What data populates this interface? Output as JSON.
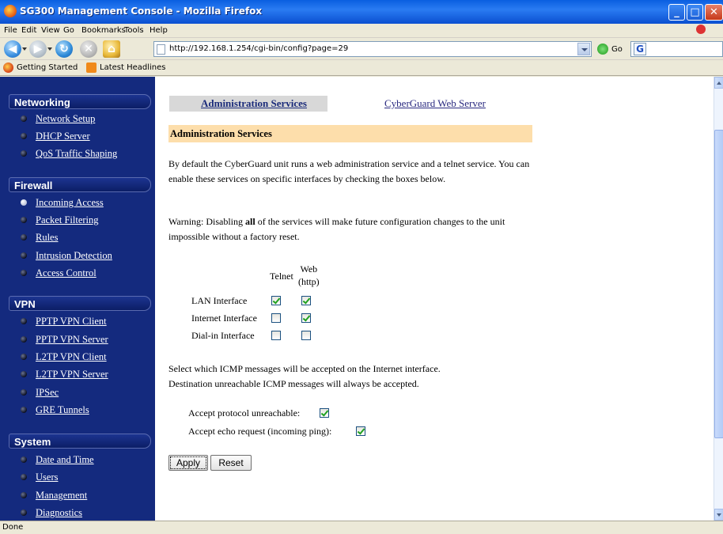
{
  "window": {
    "title": "SG300 Management Console - Mozilla Firefox"
  },
  "menu": [
    "File",
    "Edit",
    "View",
    "Go",
    "Bookmarks",
    "Tools",
    "Help"
  ],
  "toolbar": {
    "url": "http://192.168.1.254/cgi-bin/config?page=29",
    "go_label": "Go",
    "search_engine_glyph": "G"
  },
  "bookmarks": [
    "Getting Started",
    "Latest Headlines"
  ],
  "sidebar": {
    "networking": {
      "title": "Networking",
      "items": [
        "Network Setup",
        "DHCP Server",
        "QoS Traffic Shaping"
      ]
    },
    "firewall": {
      "title": "Firewall",
      "items": [
        "Incoming Access",
        "Packet Filtering",
        "Rules",
        "Intrusion Detection",
        "Access Control"
      ],
      "active": "Incoming Access"
    },
    "vpn": {
      "title": "VPN",
      "items": [
        "PPTP VPN Client",
        "PPTP VPN Server",
        "L2TP VPN Client",
        "L2TP VPN Server",
        "IPSec",
        "GRE Tunnels"
      ]
    },
    "system": {
      "title": "System",
      "items": [
        "Date and Time",
        "Users",
        "Management",
        "Diagnostics"
      ]
    }
  },
  "main": {
    "tabs": [
      "Administration Services",
      "CyberGuard Web Server"
    ],
    "section_title": "Administration Services",
    "intro": "By default the CyberGuard unit runs a web administration service and a telnet service. You can enable these services on specific interfaces by checking the boxes below.",
    "warning_prefix": "Warning: Disabling ",
    "warning_bold": "all",
    "warning_suffix": " of the services will make future configuration changes to the unit impossible without a factory reset.",
    "columns": {
      "telnet": "Telnet",
      "web_line1": "Web",
      "web_line2": "(http)"
    },
    "interfaces": [
      {
        "label": "LAN Interface",
        "telnet": true,
        "web": true
      },
      {
        "label": "Internet Interface",
        "telnet": false,
        "web": true
      },
      {
        "label": "Dial-in Interface",
        "telnet": false,
        "web": false
      }
    ],
    "icmp_line1": "Select which ICMP messages will be accepted on the Internet interface.",
    "icmp_line2": "Destination unreachable ICMP messages will always be accepted.",
    "icmp_options": [
      {
        "label": "Accept protocol unreachable:",
        "checked": true
      },
      {
        "label": "Accept echo request (incoming ping):",
        "checked": true
      }
    ],
    "apply_label": "Apply",
    "reset_label": "Reset"
  },
  "status": "Done"
}
